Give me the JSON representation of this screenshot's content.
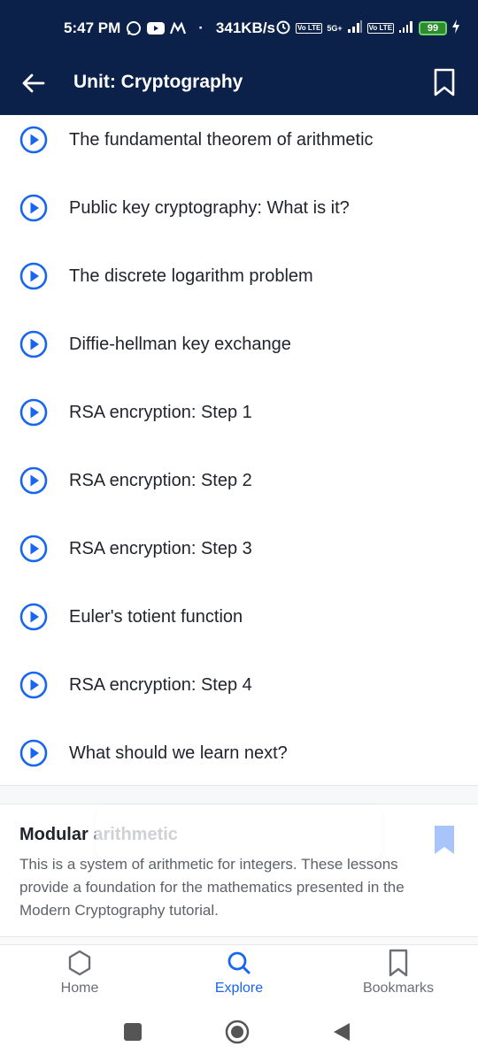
{
  "status_bar": {
    "time": "5:47 PM",
    "speed": "341KB/s",
    "battery": "99",
    "network_label": "5G+",
    "lte_label": "Vo LTE"
  },
  "app_bar": {
    "title": "Unit: Cryptography"
  },
  "lessons": [
    {
      "label": "The fundamental theorem of arithmetic"
    },
    {
      "label": "Public key cryptography: What is it?"
    },
    {
      "label": "The discrete logarithm problem"
    },
    {
      "label": "Diffie-hellman key exchange"
    },
    {
      "label": "RSA encryption: Step 1"
    },
    {
      "label": "RSA encryption: Step 2"
    },
    {
      "label": "RSA encryption: Step 3"
    },
    {
      "label": "Euler's totient function"
    },
    {
      "label": "RSA encryption: Step 4"
    },
    {
      "label": "What should we learn next?"
    }
  ],
  "next_unit": {
    "title_main": "Modular",
    "title_rest": " arithmetic",
    "description": "This is a system of arithmetic for integers. These lessons provide a foundation for the mathematics presented in the Modern Cryptography tutorial."
  },
  "bottom_nav": {
    "tabs": [
      {
        "label": "Home",
        "icon": "hexagon-icon"
      },
      {
        "label": "Explore",
        "icon": "search-icon",
        "active": true
      },
      {
        "label": "Bookmarks",
        "icon": "bookmark-icon"
      }
    ]
  },
  "colors": {
    "header_bg": "#0b2149",
    "accent_blue": "#1865f2",
    "bookmark_light": "#a9c4fb"
  }
}
